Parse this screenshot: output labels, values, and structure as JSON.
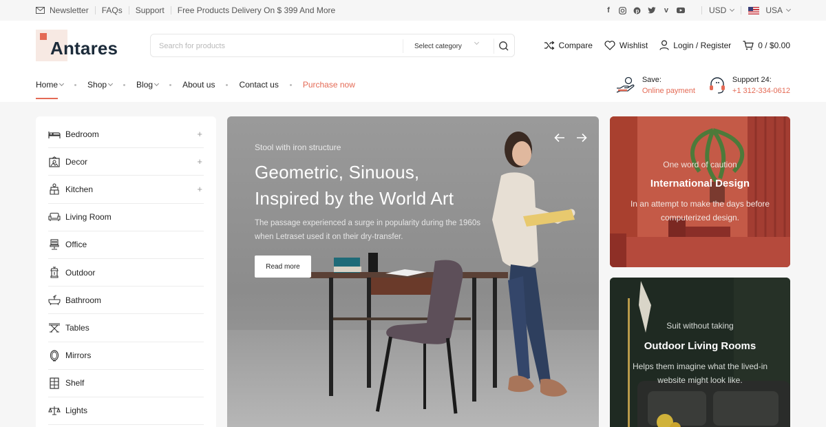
{
  "topbar": {
    "newsletter": "Newsletter",
    "faqs": "FAQs",
    "support": "Support",
    "delivery": "Free Products Delivery On $ 399 And More",
    "social": [
      "facebook-icon",
      "instagram-icon",
      "pinterest-icon",
      "twitter-icon",
      "vimeo-icon",
      "youtube-icon"
    ],
    "currency": "USD",
    "country": "USA"
  },
  "header": {
    "logo": "Antares",
    "search_placeholder": "Search for products",
    "category_label": "Select category",
    "compare": "Compare",
    "wishlist": "Wishlist",
    "login": "Login / Register",
    "cart": "0 / $0.00"
  },
  "nav": {
    "items": [
      {
        "label": "Home",
        "dropdown": true,
        "active": true
      },
      {
        "label": "Shop",
        "dropdown": true
      },
      {
        "label": "Blog",
        "dropdown": true
      },
      {
        "label": "About us"
      },
      {
        "label": "Contact us"
      },
      {
        "label": "Purchase now",
        "accent": true
      }
    ]
  },
  "services": [
    {
      "title": "Save:",
      "subtitle": "Online payment",
      "icon": "hand-payment-icon"
    },
    {
      "title": "Support 24:",
      "subtitle": "+1 312-334-0612",
      "icon": "headset-icon"
    }
  ],
  "sidebar": {
    "items": [
      {
        "label": "Bedroom",
        "icon": "bed-icon",
        "expandable": true
      },
      {
        "label": "Decor",
        "icon": "frame-icon",
        "expandable": true
      },
      {
        "label": "Kitchen",
        "icon": "kitchen-icon",
        "expandable": true
      },
      {
        "label": "Living Room",
        "icon": "sofa-icon"
      },
      {
        "label": "Office",
        "icon": "office-chair-icon"
      },
      {
        "label": "Outdoor",
        "icon": "lantern-icon"
      },
      {
        "label": "Bathroom",
        "icon": "bathtub-icon"
      },
      {
        "label": "Tables",
        "icon": "table-icon"
      },
      {
        "label": "Mirrors",
        "icon": "mirror-icon"
      },
      {
        "label": "Shelf",
        "icon": "shelf-icon"
      },
      {
        "label": "Lights",
        "icon": "lamp-icon"
      }
    ]
  },
  "hero": {
    "eyebrow": "Stool with iron structure",
    "title_line1": "Geometric, Sinuous,",
    "title_line2": "Inspired by the World Art",
    "description": "The passage experienced a surge in popularity during the 1960s when Letraset used it on their dry-transfer.",
    "cta": "Read more"
  },
  "promos": [
    {
      "eyebrow": "One word of caution",
      "title": "International Design",
      "description": "In an attempt to make the days before computerized design."
    },
    {
      "eyebrow": "Suit without taking",
      "title": "Outdoor Living Rooms",
      "description": "Helps them imagine what the lived-in website might look like."
    }
  ],
  "colors": {
    "accent": "#e46a55",
    "brand_dark": "#1c2b3a"
  }
}
